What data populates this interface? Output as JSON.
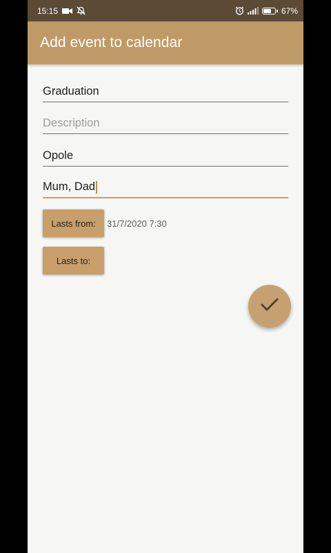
{
  "status_bar": {
    "time": "15:15",
    "battery_percent": "67%",
    "icons": [
      "video-camera-icon",
      "notifications-off-icon",
      "alarm-icon",
      "signal-icon",
      "battery-icon"
    ]
  },
  "app_bar": {
    "title": "Add event to calendar"
  },
  "form": {
    "title_value": "Graduation",
    "description_placeholder": "Description",
    "location_value": "Opole",
    "attendees_value": "Mum, Dad",
    "lasts_from_label": "Lasts from:",
    "lasts_from_value": "31/7/2020 7:30",
    "lasts_to_label": "Lasts to:"
  },
  "fab": {
    "icon": "check-icon"
  },
  "colors": {
    "primary": "#c09a66",
    "status_bar": "#5b4a36",
    "button": "#c89e6b",
    "focus_underline": "#c99e6c",
    "background": "#f6f6f4"
  }
}
